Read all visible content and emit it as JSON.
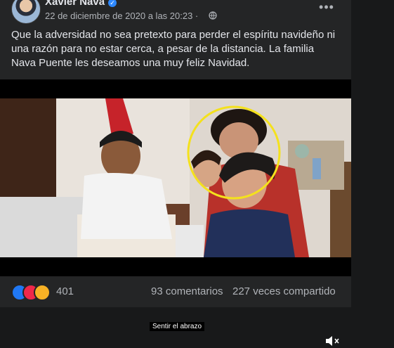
{
  "post": {
    "author": "Xavier Nava",
    "date": "22 de diciembre de 2020 a las 20:23 ·",
    "text": "Que la adversidad no sea pretexto para perder el espíritu navideño ni una razón para no estar cerca, a pesar de la distancia. La familia Nava Puente les deseamos una muy feliz Navidad.",
    "more_icon": "more-dots-icon",
    "privacy_icon": "globe-icon"
  },
  "video": {
    "caption": "Sentir el abrazo",
    "mute_icon": "speaker-muted-icon"
  },
  "footer": {
    "reaction_count": "401",
    "comments": "93 comentarios",
    "shares": "227 veces compartido",
    "reaction_icons": [
      "like-icon",
      "love-icon",
      "care-icon"
    ]
  },
  "colors": {
    "card": "#242526",
    "accent": "#2d88ff",
    "highlight_circle": "#f4e11d"
  }
}
